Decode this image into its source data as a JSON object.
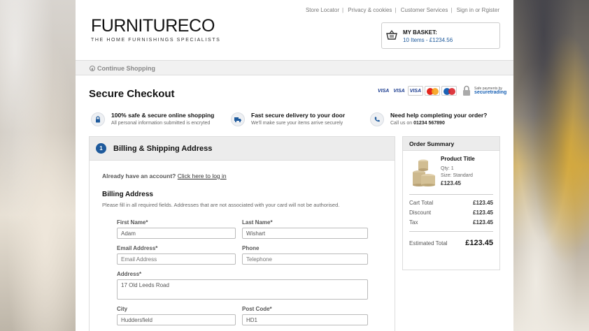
{
  "header": {
    "logo_main": "FURNITURE",
    "logo_co": "CO",
    "logo_tagline": "THE HOME FURNISHINGS SPECIALISTS",
    "links": [
      "Store Locator",
      "Privacy & cookies",
      "Customer Services",
      "Sign in or Rgister"
    ],
    "basket_title": "MY BASKET:",
    "basket_items": "10 Items - £1234.56"
  },
  "nav": {
    "continue": "Continue Shopping"
  },
  "page_title": "Secure Checkout",
  "payment": {
    "cards": [
      "VISA",
      "VISA",
      "VISA"
    ],
    "secure_small": "Safe payments by",
    "secure_brand": "securetrading"
  },
  "features": [
    {
      "title": "100% safe & secure online shopping",
      "sub": "All personal information submitted is encryted",
      "icon": "lock-icon"
    },
    {
      "title": "Fast secure delivery to your door",
      "sub": "We'll make sure your items arrive securely",
      "icon": "truck-icon"
    },
    {
      "title": "Need help completing your order?",
      "sub_prefix": "Call us on ",
      "phone": "01234 567890",
      "icon": "phone-icon"
    }
  ],
  "billing": {
    "step": "1",
    "title": "Billing & Shipping Address",
    "already": "Already have an account?",
    "login_link": "Click here to log in",
    "heading": "Billing Address",
    "sub": "Please fill in all required fields. Addresses that are not associated with your card will not be authorised.",
    "fields": {
      "first_name": {
        "label": "First Name*",
        "value": "Adam"
      },
      "last_name": {
        "label": "Last Name*",
        "value": "Wishart"
      },
      "email": {
        "label": "Email Address*",
        "placeholder": "Email Address"
      },
      "phone": {
        "label": "Phone",
        "placeholder": "Telephone"
      },
      "address": {
        "label": "Address*",
        "value": "17 Old Leeds Road"
      },
      "city": {
        "label": "City",
        "value": "Huddersfield"
      },
      "post_code": {
        "label": "Post Code*",
        "value": "HD1"
      }
    }
  },
  "summary": {
    "title": "Order Summary",
    "product": {
      "title": "Product Title",
      "qty": "Qty: 1",
      "size": "Size: Standard",
      "price": "£123.45"
    },
    "rows": [
      {
        "label": "Cart Total",
        "value": "£123.45"
      },
      {
        "label": "Discount",
        "value": "£123.45"
      },
      {
        "label": "Tax",
        "value": "£123.45"
      }
    ],
    "estimated_label": "Estimated Total",
    "estimated_value": "£123.45"
  },
  "colors": {
    "accent": "#1e5a9c",
    "panel_bg": "#ececec"
  }
}
